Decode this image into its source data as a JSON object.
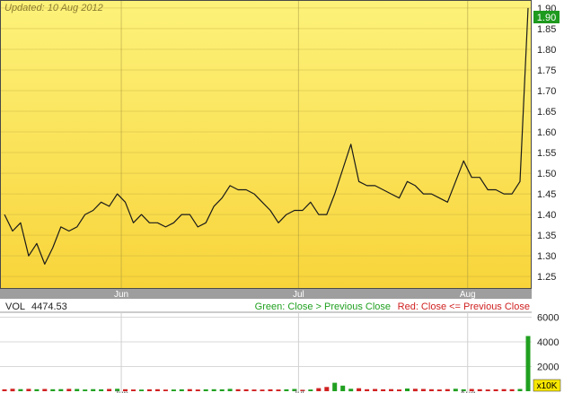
{
  "updated_label": "Updated: 10 Aug 2012",
  "vol_label": "VOL",
  "vol_value": "4474.53",
  "legend": {
    "green": "Green: Close > Previous Close",
    "red": "Red: Close <= Previous Close"
  },
  "multiplier_label": "x10K",
  "last_price_label": "1.90",
  "colors": {
    "panel_top": "#fdf27a",
    "panel_bottom": "#f8d43a",
    "line": "#1a1a1a",
    "up": "#20a020",
    "down": "#d02020",
    "frame": "#4a4a4a",
    "price_tag": "#1e9a1e",
    "x10k_tag": "#f7e600"
  },
  "chart_data": [
    {
      "type": "line",
      "title": "",
      "xlabel": "",
      "ylabel": "",
      "x_ticks": [
        "Jun",
        "Jul",
        "Aug"
      ],
      "x_tick_index": [
        14.5,
        36.5,
        57.5
      ],
      "y_ticks": [
        "1.25",
        "1.30",
        "1.35",
        "1.40",
        "1.45",
        "1.50",
        "1.55",
        "1.60",
        "1.65",
        "1.70",
        "1.75",
        "1.80",
        "1.85",
        "1.90"
      ],
      "ylim": [
        1.22,
        1.915
      ],
      "grid": true,
      "series": [
        {
          "values": [
            1.4,
            1.36,
            1.38,
            1.3,
            1.33,
            1.28,
            1.32,
            1.37,
            1.36,
            1.37,
            1.4,
            1.41,
            1.43,
            1.42,
            1.45,
            1.43,
            1.38,
            1.4,
            1.38,
            1.38,
            1.37,
            1.38,
            1.4,
            1.4,
            1.37,
            1.38,
            1.42,
            1.44,
            1.47,
            1.46,
            1.46,
            1.45,
            1.43,
            1.41,
            1.38,
            1.4,
            1.41,
            1.41,
            1.43,
            1.4,
            1.4,
            1.45,
            1.51,
            1.57,
            1.48,
            1.47,
            1.47,
            1.46,
            1.45,
            1.44,
            1.48,
            1.47,
            1.45,
            1.45,
            1.44,
            1.43,
            1.48,
            1.53,
            1.49,
            1.49,
            1.46,
            1.46,
            1.45,
            1.45,
            1.48,
            1.9
          ]
        }
      ]
    },
    {
      "type": "bar",
      "title": "",
      "xlabel": "",
      "ylabel": "",
      "y_ticks": [
        "2000",
        "4000",
        "6000"
      ],
      "ylim": [
        0,
        6400
      ],
      "x_ticks": [
        "Jun",
        "Jul",
        "Aug"
      ],
      "grid": true,
      "series": [
        {
          "values": [
            150,
            200,
            170,
            190,
            160,
            180,
            160,
            170,
            190,
            180,
            140,
            170,
            150,
            180,
            200,
            160,
            140,
            130,
            150,
            160,
            130,
            140,
            150,
            170,
            140,
            150,
            160,
            150,
            190,
            160,
            150,
            140,
            130,
            150,
            140,
            150,
            180,
            120,
            140,
            250,
            340,
            680,
            450,
            200,
            240,
            160,
            180,
            150,
            170,
            140,
            220,
            200,
            180,
            160,
            140,
            170,
            200,
            150,
            180,
            160,
            140,
            150,
            170,
            160,
            180,
            4474.53
          ],
          "direction": [
            "d",
            "d",
            "u",
            "d",
            "u",
            "d",
            "u",
            "u",
            "d",
            "u",
            "u",
            "u",
            "u",
            "d",
            "u",
            "d",
            "d",
            "u",
            "d",
            "d",
            "d",
            "u",
            "u",
            "d",
            "d",
            "u",
            "u",
            "u",
            "u",
            "d",
            "d",
            "d",
            "d",
            "d",
            "d",
            "u",
            "u",
            "d",
            "u",
            "d",
            "d",
            "u",
            "u",
            "u",
            "d",
            "d",
            "d",
            "d",
            "d",
            "d",
            "u",
            "d",
            "d",
            "d",
            "d",
            "d",
            "u",
            "u",
            "d",
            "d",
            "d",
            "d",
            "d",
            "d",
            "u",
            "u"
          ]
        }
      ]
    }
  ]
}
